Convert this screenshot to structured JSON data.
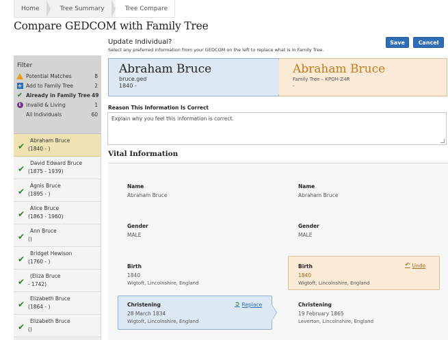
{
  "breadcrumb": [
    "Home",
    "Tree Summary",
    "Tree Compare"
  ],
  "page_title": "Compare GEDCOM with Family Tree",
  "filter": {
    "title": "Filter",
    "items": [
      {
        "label": "Potential Matches",
        "count": "8",
        "icon": "warning-icon"
      },
      {
        "label": "Add to Family Tree",
        "count": "2",
        "icon": "plus-icon"
      },
      {
        "label": "Already in Family Tree",
        "count": "49",
        "icon": "check-icon"
      },
      {
        "label": "Invalid & Living",
        "count": "1",
        "icon": "info-icon"
      },
      {
        "label": "All Individuals",
        "count": "60",
        "icon": ""
      }
    ]
  },
  "people": [
    {
      "name": "Abraham Bruce",
      "dates": "(1840 - )"
    },
    {
      "name": "David Edward Bruce",
      "dates": "(1875 - 1939)"
    },
    {
      "name": "Agnis Bruce",
      "dates": "(1895 - )"
    },
    {
      "name": "Alice Bruce",
      "dates": "(1863 - 1960)"
    },
    {
      "name": "Ann Bruce",
      "dates": "()"
    },
    {
      "name": "Bridget Hewison",
      "dates": "(1760 - )"
    },
    {
      "name": "(Eliza Bruce",
      "dates": "- 1742)"
    },
    {
      "name": "Elizabeth Bruce",
      "dates": "(1864 - )"
    },
    {
      "name": "Elizabeth Bruce",
      "dates": "()"
    }
  ],
  "update": {
    "title": "Update Individual?",
    "subtitle": "Select any preferred information from your GEDCOM on the left to replace what is in Family Tree.",
    "save_label": "Save",
    "cancel_label": "Cancel"
  },
  "compare": {
    "left_name": "Abraham Bruce",
    "left_source": "bruce.ged",
    "left_dates": "1840 -",
    "right_name": "Abraham Bruce",
    "right_source": "Family Tree – KPQH-Z4R",
    "right_dates": "-"
  },
  "reason": {
    "label": "Reason This Information Is Correct",
    "placeholder": "Explain why you feel this information is correct."
  },
  "vital": {
    "title": "Vital Information",
    "name_label": "Name",
    "gender_label": "Gender",
    "birth_label": "Birth",
    "christening_label": "Christening",
    "left": {
      "name": "Abraham Bruce",
      "gender": "MALE",
      "birth_date": "1840",
      "birth_place": "Wigtoft, Lincolnshire, England",
      "christening_date": "28 March 1834",
      "christening_place": "Wigtoft, Lincolnshire, England"
    },
    "right": {
      "name": "Abraham Bruce",
      "gender": "MALE",
      "birth_date": "1840",
      "birth_place": "Wigtoft, Lincolnshire, England",
      "christening_date": "19 February 1865",
      "christening_place": "Leverton, Lincolnshire, England"
    },
    "undo_label": "Undo",
    "replace_label": "Replace"
  },
  "colors": {
    "accent": "#2f6db5",
    "gedcom_bg": "#dde8f5",
    "tree_bg": "#fbead6",
    "tree_name": "#c7791c"
  }
}
